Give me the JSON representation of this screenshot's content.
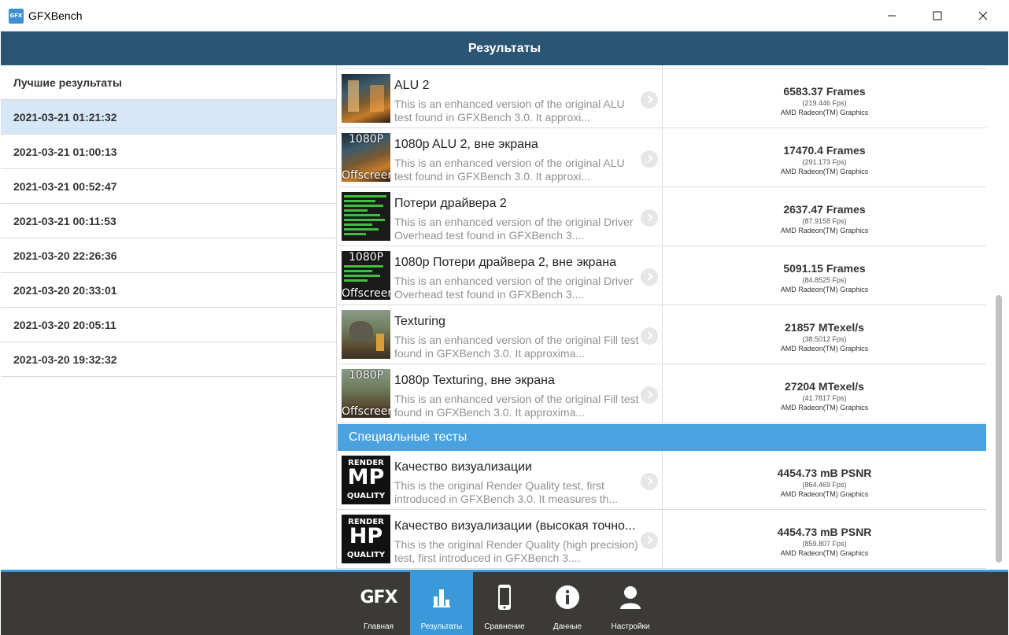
{
  "window": {
    "app_icon": "GFX",
    "title": "GFXBench",
    "minimize_icon": "minimize-icon",
    "maximize_icon": "maximize-icon",
    "close_icon": "close-icon"
  },
  "header": {
    "title": "Результаты"
  },
  "sidebar": {
    "heading": "Лучшие результаты",
    "items": [
      {
        "label": "2021-03-21 01:21:32",
        "selected": true
      },
      {
        "label": "2021-03-21 01:00:13"
      },
      {
        "label": "2021-03-21 00:52:47"
      },
      {
        "label": "2021-03-21 00:11:53"
      },
      {
        "label": "2021-03-20 22:26:36"
      },
      {
        "label": "2021-03-20 20:33:01"
      },
      {
        "label": "2021-03-20 20:05:11"
      },
      {
        "label": "2021-03-20 19:32:32"
      }
    ]
  },
  "tests": [
    {
      "name": "ALU 2",
      "desc": "This is an enhanced version of the original ALU test found in GFXBench 3.0. It approxi...",
      "score": "6583.37 Frames",
      "fps": "(219.446 Fps)",
      "gpu": "AMD Radeon(TM) Graphics",
      "overlay_top": "",
      "overlay_bottom": ""
    },
    {
      "name": "1080p ALU 2, вне экрана",
      "desc": "This is an enhanced version of the original ALU test found in GFXBench 3.0. It approxi...",
      "score": "17470.4 Frames",
      "fps": "(291.173 Fps)",
      "gpu": "AMD Radeon(TM) Graphics",
      "overlay_top": "1080P",
      "overlay_bottom": "Offscreen"
    },
    {
      "name": "Потери драйвера 2",
      "desc": "This is an enhanced version of the original Driver Overhead test found in GFXBench 3....",
      "score": "2637.47 Frames",
      "fps": "(87.9158 Fps)",
      "gpu": "AMD Radeon(TM) Graphics",
      "overlay_top": "",
      "overlay_bottom": ""
    },
    {
      "name": "1080p Потери драйвера 2, вне экрана",
      "desc": "This is an enhanced version of the original Driver Overhead test found in GFXBench 3....",
      "score": "5091.15 Frames",
      "fps": "(84.8525 Fps)",
      "gpu": "AMD Radeon(TM) Graphics",
      "overlay_top": "1080P",
      "overlay_bottom": "Offscreen"
    },
    {
      "name": "Texturing",
      "desc": "This is an enhanced version of the original Fill test found in GFXBench 3.0. It approxima...",
      "score": "21857 MTexel/s",
      "fps": "(38.5012 Fps)",
      "gpu": "AMD Radeon(TM) Graphics",
      "overlay_top": "",
      "overlay_bottom": ""
    },
    {
      "name": "1080p Texturing, вне экрана",
      "desc": "This is an enhanced version of the original Fill test found in GFXBench 3.0. It approxima...",
      "score": "27204 MTexel/s",
      "fps": "(41.7817 Fps)",
      "gpu": "AMD Radeon(TM) Graphics",
      "overlay_top": "1080P",
      "overlay_bottom": "Offscreen"
    }
  ],
  "special_section": {
    "title": "Специальные тесты"
  },
  "special_tests": [
    {
      "name": "Качество визуализации",
      "desc": "This is the original Render Quality test, first introduced in GFXBench 3.0. It measures th...",
      "score": "4454.73 mB PSNR",
      "fps": "(864.469 Fps)",
      "gpu": "AMD Radeon(TM) Graphics",
      "badge_top": "RENDER",
      "badge_mid": "MP",
      "badge_bot": "QUALITY"
    },
    {
      "name": "Качество визуализации (высокая точно...",
      "desc": "This is the original Render Quality (high precision) test, first introduced in GFXBench 3....",
      "score": "4454.73 mB PSNR",
      "fps": "(859.807 Fps)",
      "gpu": "AMD Radeon(TM) Graphics",
      "badge_top": "RENDER",
      "badge_mid": "HP",
      "badge_bot": "QUALITY"
    }
  ],
  "bottom_nav": {
    "gfx_logo": "GFX",
    "items": [
      {
        "label": "Главная",
        "icon": "gfx-logo-icon"
      },
      {
        "label": "Результаты",
        "icon": "bar-chart-icon",
        "active": true
      },
      {
        "label": "Сравнение",
        "icon": "phone-icon"
      },
      {
        "label": "Данные",
        "icon": "info-icon"
      },
      {
        "label": "Настройки",
        "icon": "user-icon"
      }
    ]
  },
  "colors": {
    "header_bg": "#2b5575",
    "accent": "#3a9ad9",
    "section_bg": "#4aa3e0",
    "selected_bg": "#d6e8f8",
    "bottom_bg": "#3b3a37"
  }
}
